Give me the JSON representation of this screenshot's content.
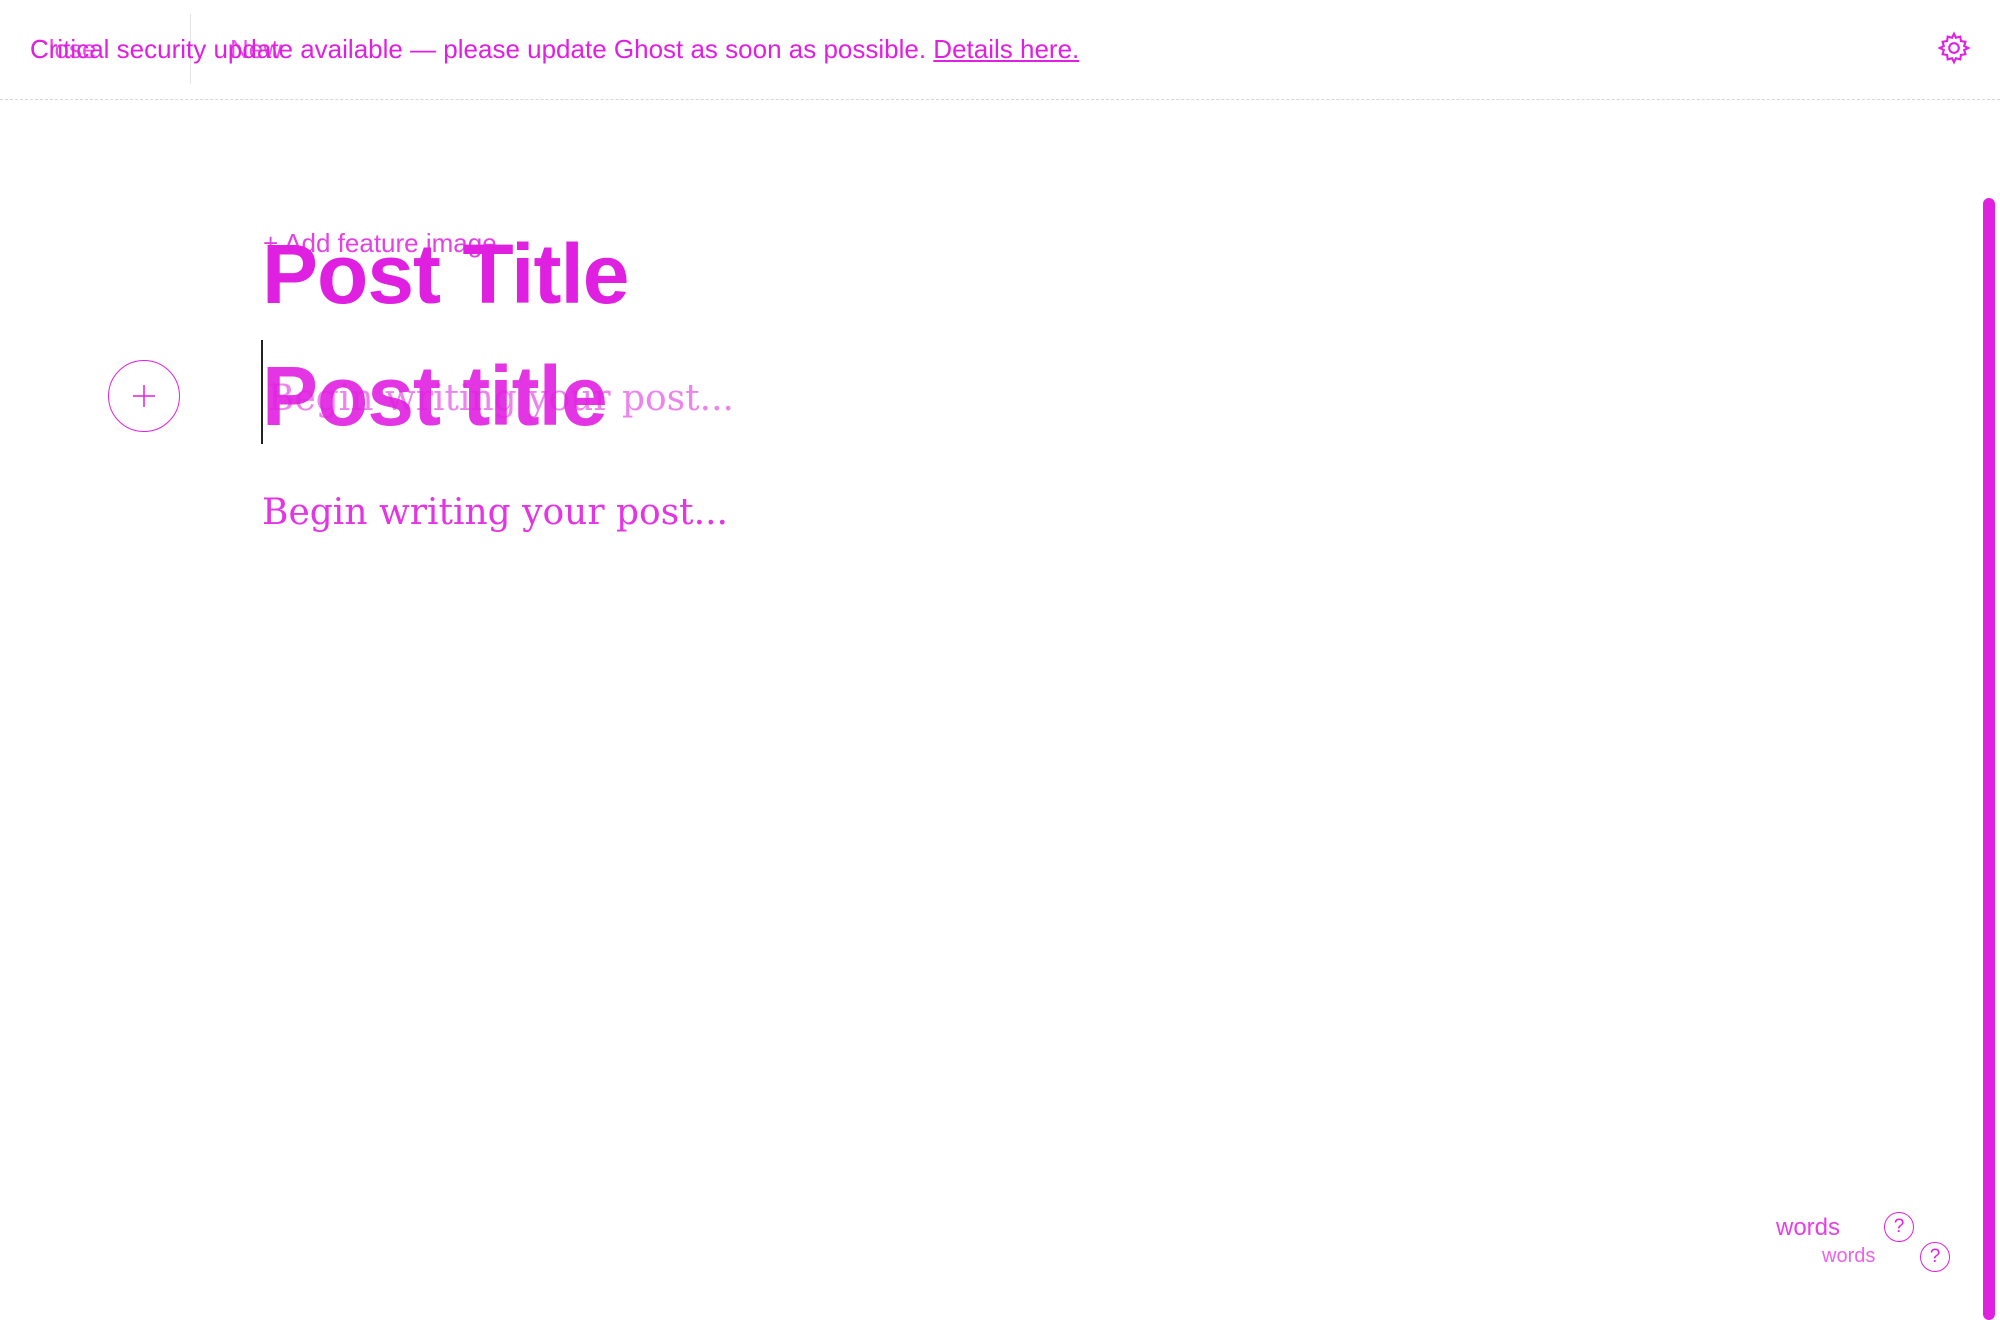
{
  "header": {
    "close_label": "Close",
    "new_label": "New",
    "banner_text": "Critical security update available — please update Ghost as soon as possible.",
    "banner_link": "Details here.",
    "settings_icon": "gear-icon"
  },
  "editor": {
    "feature_image_label": "Add feature image",
    "title_primary": "Post Title",
    "title_placeholder": "Post title",
    "body_placeholder": "Begin writing your post...",
    "add_card_icon": "plus-circle-icon"
  },
  "footer": {
    "word_count_label": "words",
    "word_count_label_secondary": "words",
    "help_icon": "question-circle-icon"
  },
  "colors": {
    "accent": "#e020e0"
  }
}
